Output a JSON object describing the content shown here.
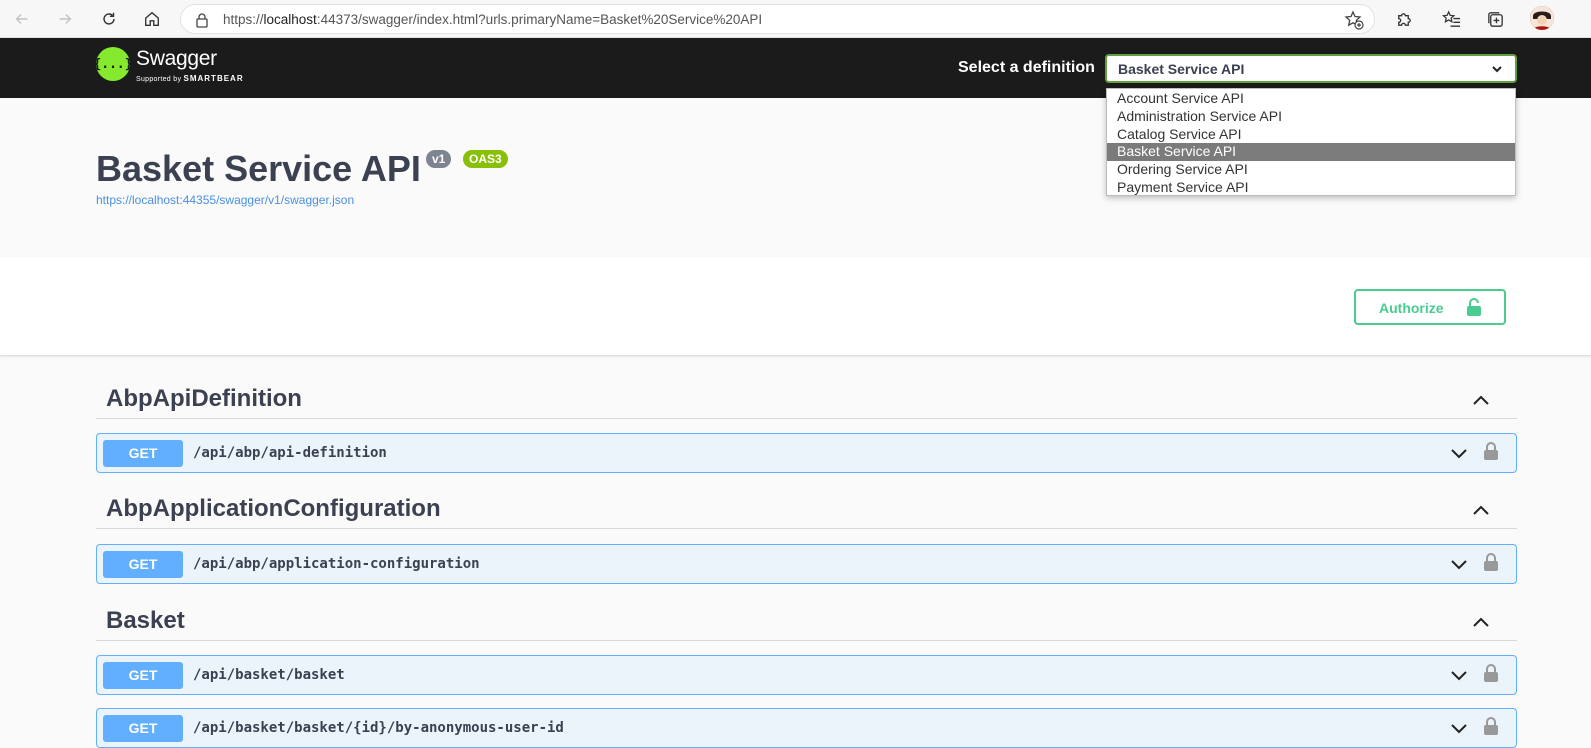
{
  "browser": {
    "url_prefix": "https://",
    "url_host": "localhost",
    "url_rest": ":44373/swagger/index.html?urls.primaryName=Basket%20Service%20API"
  },
  "topbar": {
    "logo_title": "Swagger",
    "logo_sub_prefix": "Supported by ",
    "logo_sub_brand": "SMARTBEAR",
    "definition_label": "Select a definition",
    "selected_definition": "Basket Service API",
    "definitions": [
      "Account Service API",
      "Administration Service API",
      "Catalog Service API",
      "Basket Service API",
      "Ordering Service API",
      "Payment Service API"
    ]
  },
  "info": {
    "title": "Basket Service API",
    "version_badge": "v1",
    "oas_badge": "OAS3",
    "json_link": "https://localhost:44355/swagger/v1/swagger.json"
  },
  "auth": {
    "authorize_label": "Authorize"
  },
  "tags": [
    {
      "name": "AbpApiDefinition"
    },
    {
      "name": "AbpApplicationConfiguration"
    },
    {
      "name": "Basket"
    }
  ],
  "operations": [
    {
      "method": "GET",
      "path": "/api/abp/api-definition"
    },
    {
      "method": "GET",
      "path": "/api/abp/application-configuration"
    },
    {
      "method": "GET",
      "path": "/api/basket/basket"
    },
    {
      "method": "GET",
      "path": "/api/basket/basket/{id}/by-anonymous-user-id"
    }
  ],
  "colors": {
    "get": "#61affe",
    "authorize": "#49cc90",
    "topbar": "#1b1b1b",
    "logo": "#85ea2d"
  }
}
